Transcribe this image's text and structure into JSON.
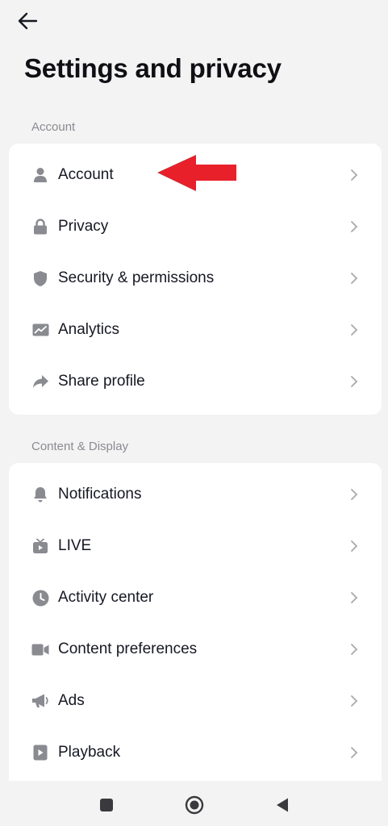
{
  "header": {
    "back_icon": "arrow-left-icon",
    "title": "Settings and privacy"
  },
  "sections": [
    {
      "label": "Account",
      "items": [
        {
          "label": "Account",
          "icon": "person-icon"
        },
        {
          "label": "Privacy",
          "icon": "lock-icon"
        },
        {
          "label": "Security & permissions",
          "icon": "shield-icon"
        },
        {
          "label": "Analytics",
          "icon": "chart-icon"
        },
        {
          "label": "Share profile",
          "icon": "share-icon"
        }
      ]
    },
    {
      "label": "Content & Display",
      "items": [
        {
          "label": "Notifications",
          "icon": "bell-icon"
        },
        {
          "label": "LIVE",
          "icon": "live-tv-icon"
        },
        {
          "label": "Activity center",
          "icon": "clock-icon"
        },
        {
          "label": "Content preferences",
          "icon": "video-camera-icon"
        },
        {
          "label": "Ads",
          "icon": "megaphone-icon"
        },
        {
          "label": "Playback",
          "icon": "play-icon"
        }
      ]
    }
  ],
  "annotation": {
    "color": "#e8202a",
    "shape": "arrow-left"
  },
  "navbar": {
    "recents_icon": "square-icon",
    "home_icon": "circle-icon",
    "back_icon": "triangle-back-icon"
  },
  "colors": {
    "background": "#f3f3f3",
    "card": "#ffffff",
    "icon": "#8a8b91",
    "text": "#161823",
    "section_label": "#8a8b91"
  }
}
